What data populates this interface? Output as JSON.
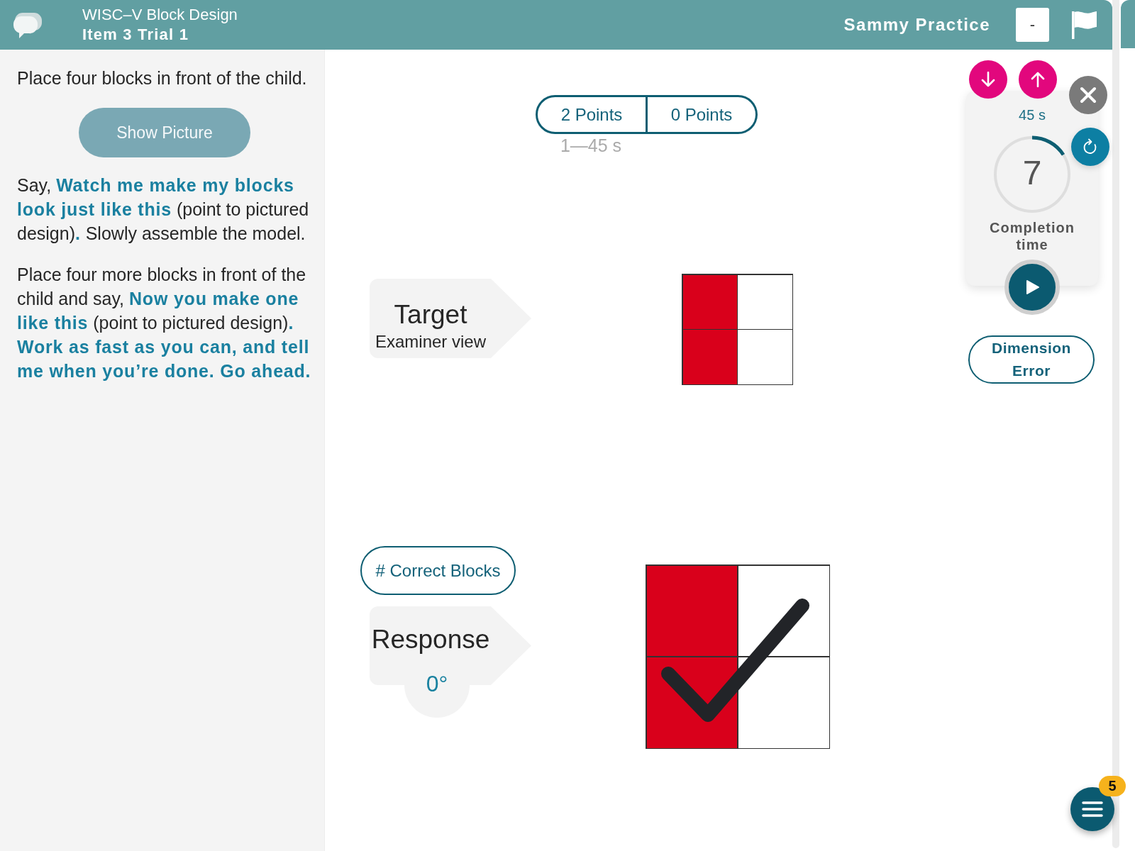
{
  "header": {
    "title": "WISC–V Block Design",
    "subtitle": "Item 3 Trial 1",
    "examinee": "Sammy Practice",
    "collapse_button": "-"
  },
  "instructions": {
    "blocks": [
      {
        "kind": "text",
        "text": "Place four blocks in front of the child."
      },
      {
        "kind": "button",
        "label": "Show Picture"
      },
      {
        "kind": "text",
        "text": "Say, **Watch me make my blocks look just like this** (point to pictured design)**.** Slowly assemble the model."
      },
      {
        "kind": "text",
        "text": "Place four more blocks in front of the child and say, **Now you make one like this** (point to pictured design)**. Work as fast as you can, and tell me when you’re done. Go ahead.**"
      }
    ]
  },
  "scoring": {
    "options": [
      {
        "label": "2 Points",
        "selected": false
      },
      {
        "label": "0 Points",
        "selected": false
      }
    ],
    "time_range": "1—45 s"
  },
  "target": {
    "title": "Target",
    "subtitle": "Examiner view",
    "rows": [
      [
        {
          "kind": "red"
        },
        {
          "kind": "white"
        }
      ],
      [
        {
          "kind": "red"
        },
        {
          "kind": "white"
        }
      ]
    ]
  },
  "response": {
    "correct_blocks_button": "# Correct Blocks",
    "title": "Response",
    "rotation": "0°",
    "correct": true,
    "rows": [
      [
        {
          "kind": "red"
        },
        {
          "kind": "white"
        }
      ],
      [
        {
          "kind": "red"
        },
        {
          "kind": "white"
        }
      ]
    ]
  },
  "timer": {
    "time_limit": "45 s",
    "elapsed": "7",
    "level": 0.16,
    "caption": "Completion time",
    "running": false
  },
  "dimension_error_button": "Dimension Error",
  "menu": {
    "badge": "5"
  }
}
